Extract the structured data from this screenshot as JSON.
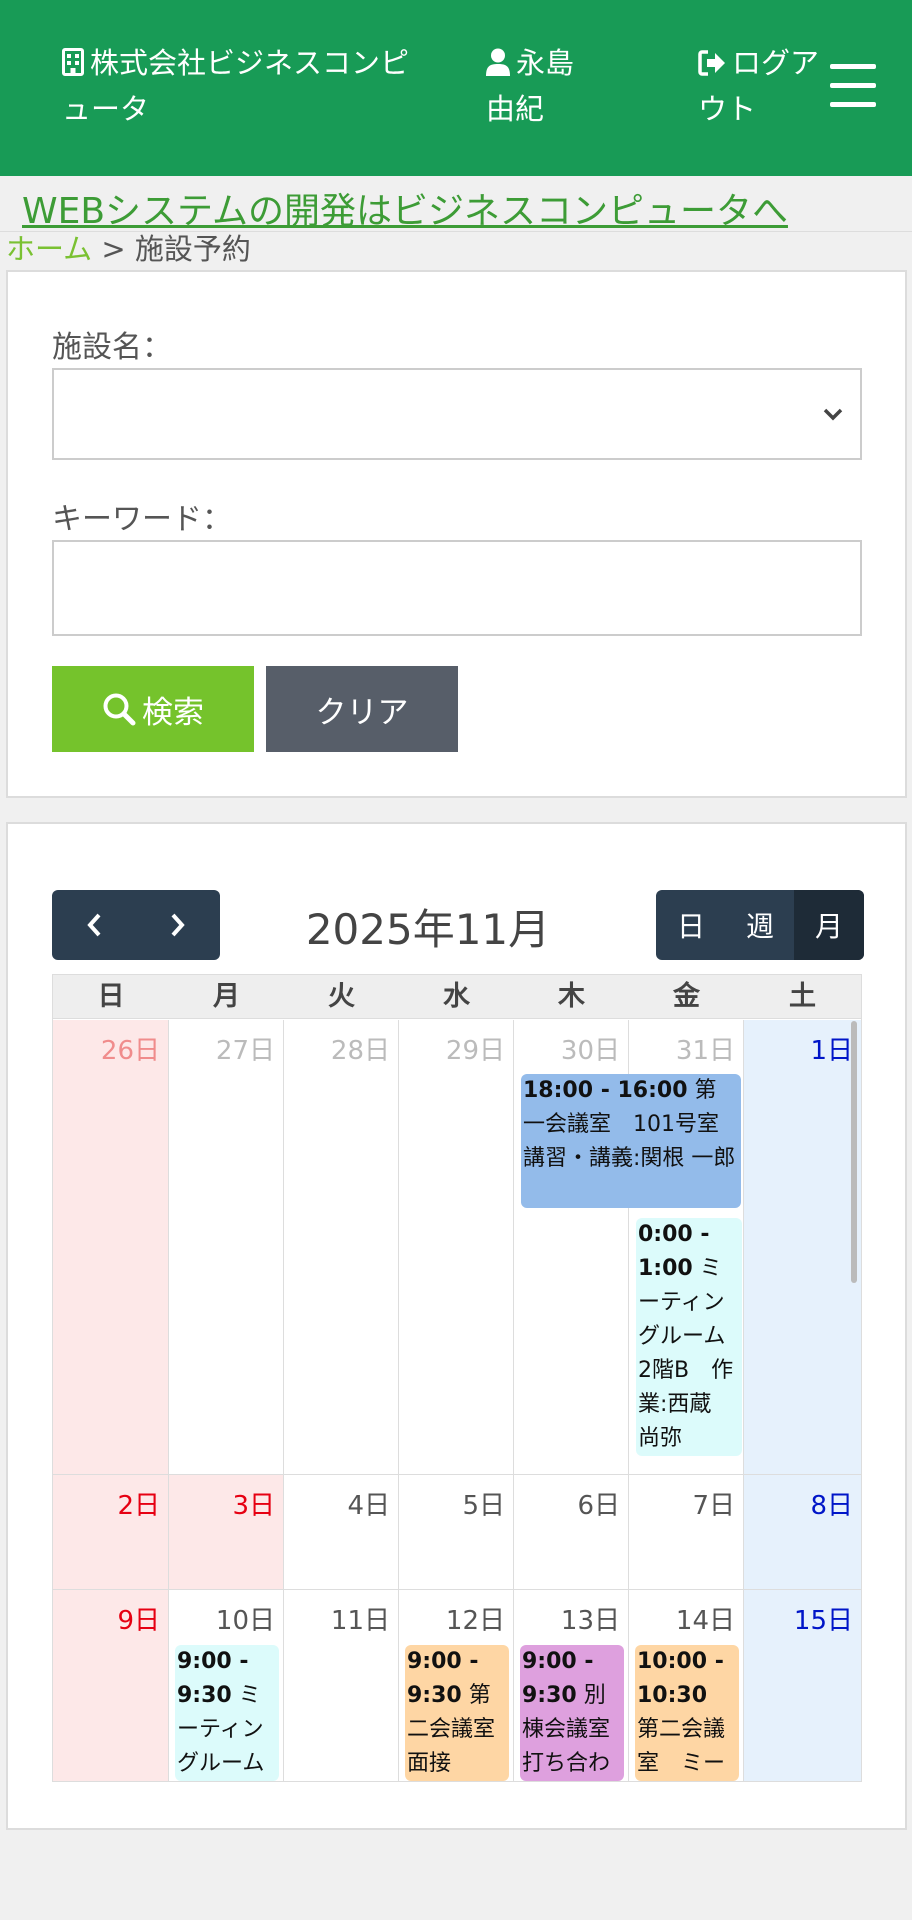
{
  "header": {
    "company": "株式会社ビジネスコンピュータ",
    "user": "永島 由紀",
    "logout": "ログアウト",
    "company_icon": "building-icon",
    "user_icon": "user-icon",
    "logout_icon": "sign-out-icon",
    "menu_icon": "hamburger-menu-icon",
    "color": "#189b56"
  },
  "banner": {
    "link": "WEBシステムの開発はビジネスコンピュータへ"
  },
  "breadcrumb": {
    "home": "ホーム",
    "separator": ">",
    "current": "施設予約"
  },
  "search": {
    "facility_label": "施設名：",
    "facility_value": "",
    "keyword_label": "キーワード：",
    "keyword_value": "",
    "keyword_placeholder": "",
    "search_button": "検索",
    "clear_button": "クリア",
    "search_color": "#75c32c",
    "clear_color": "#575e69"
  },
  "calendar": {
    "title": "2025年11月",
    "prev_icon": "chevron-left-icon",
    "next_icon": "chevron-right-icon",
    "views": [
      "日",
      "週",
      "月"
    ],
    "active_view": "月",
    "weekdays": [
      "日",
      "月",
      "火",
      "水",
      "木",
      "金",
      "土"
    ],
    "weeks": [
      [
        "26日",
        "27日",
        "28日",
        "29日",
        "30日",
        "31日",
        "1日"
      ],
      [
        "2日",
        "3日",
        "4日",
        "5日",
        "6日",
        "7日",
        "8日"
      ],
      [
        "9日",
        "10日",
        "11日",
        "12日",
        "13日",
        "14日",
        "15日"
      ]
    ],
    "events": [
      {
        "time": "18:00 - 16:00",
        "text": "第一会議室　101号室　講習・講義:関根 一郎",
        "color": "#93bbea"
      },
      {
        "time": "0:00 - 1:00",
        "text": "ミーティングルーム2階B　作業:西蔵　尚弥",
        "color": "#dcfbfb"
      },
      {
        "time": "9:00 - 9:30",
        "text": "ミーティングルーム",
        "color": "#dcfbfb"
      },
      {
        "time": "9:00 - 9:30",
        "text": "第二会議室　面接",
        "color": "#fed6a4"
      },
      {
        "time": "9:00 - 9:30",
        "text": "別棟会議室　打ち合わ",
        "color": "#dea0de"
      },
      {
        "time": "10:00 - 10:30",
        "text": "第二会議室　ミーティ",
        "color": "#fed6a4"
      }
    ]
  }
}
